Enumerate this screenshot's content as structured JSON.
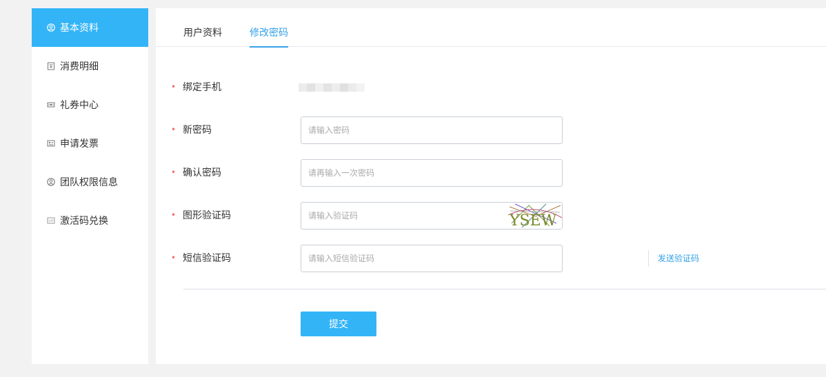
{
  "sidebar": {
    "items": [
      {
        "label": "基本资料",
        "icon": "user-circle-icon",
        "active": true
      },
      {
        "label": "消费明细",
        "icon": "receipt-icon",
        "active": false
      },
      {
        "label": "礼券中心",
        "icon": "ticket-icon",
        "active": false
      },
      {
        "label": "申请发票",
        "icon": "invoice-icon",
        "active": false
      },
      {
        "label": "团队权限信息",
        "icon": "user-circle-icon",
        "active": false
      },
      {
        "label": "激活码兑换",
        "icon": "code-icon",
        "active": false
      }
    ]
  },
  "tabs": [
    {
      "label": "用户资料",
      "active": false
    },
    {
      "label": "修改密码",
      "active": true
    }
  ],
  "form": {
    "bind_phone": {
      "label": "绑定手机",
      "required_mark": "•"
    },
    "new_password": {
      "label": "新密码",
      "required_mark": "•",
      "placeholder": "请输入密码",
      "value": ""
    },
    "confirm_password": {
      "label": "确认密码",
      "required_mark": "•",
      "placeholder": "请再输入一次密码",
      "value": ""
    },
    "captcha": {
      "label": "图形验证码",
      "required_mark": "•",
      "placeholder": "请输入验证码",
      "value": "",
      "image_text": "YSEW"
    },
    "sms_code": {
      "label": "短信验证码",
      "required_mark": "•",
      "placeholder": "请输入短信验证码",
      "value": "",
      "send_label": "发送验证码"
    },
    "submit_label": "提交"
  },
  "colors": {
    "accent": "#33b4f7",
    "link": "#33a0e8",
    "required": "#f56c6c",
    "background": "#f2f2f2"
  }
}
